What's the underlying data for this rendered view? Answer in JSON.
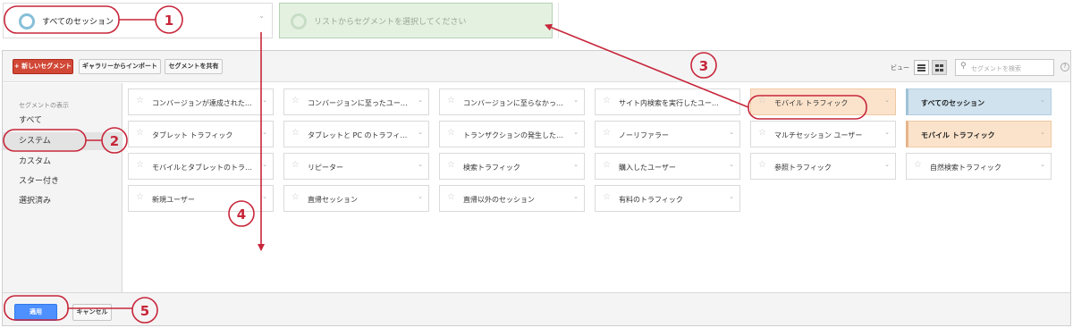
{
  "segment_bar": {
    "slot1_label": "すべてのセッション",
    "slot2_label": "リストからセグメントを選択してください"
  },
  "toolbar": {
    "new_segment": "+ 新しいセグメント",
    "import_gallery": "ギャラリーからインポート",
    "share_segments": "セグメントを共有",
    "view_label": "ビュー",
    "search_placeholder": "セグメントを検索",
    "help": "?"
  },
  "sidebar": {
    "heading": "セグメントの表示",
    "items": [
      {
        "label": "すべて"
      },
      {
        "label": "システム"
      },
      {
        "label": "カスタム"
      },
      {
        "label": "スター付き"
      },
      {
        "label": "選択済み"
      }
    ]
  },
  "segments": [
    {
      "label": "コンバージョンが達成されたセ..."
    },
    {
      "label": "コンバージョンに至ったユーザー"
    },
    {
      "label": "コンバージョンに至らなかった..."
    },
    {
      "label": "サイト内検索を実行したユーザー"
    },
    {
      "label": "モバイル トラフィック"
    },
    {
      "label": "すべてのセッション"
    },
    {
      "label": "タブレット トラフィック"
    },
    {
      "label": "タブレットと PC のトラフィック"
    },
    {
      "label": "トランザクションの発生したセッ..."
    },
    {
      "label": "ノーリファラー"
    },
    {
      "label": "マルチセッション ユーザー"
    },
    {
      "label": "モバイル トラフィック"
    },
    {
      "label": "モバイルとタブレットのトラフィック"
    },
    {
      "label": "リピーター"
    },
    {
      "label": "検索トラフィック"
    },
    {
      "label": "購入したユーザー"
    },
    {
      "label": "参照トラフィック"
    },
    {
      "label": "自然検索トラフィック"
    },
    {
      "label": "新規ユーザー"
    },
    {
      "label": "直帰セッション"
    },
    {
      "label": "直帰以外のセッション"
    },
    {
      "label": "有料のトラフィック"
    }
  ],
  "footer": {
    "apply": "適用",
    "cancel": "キャンセル"
  },
  "annotations": [
    "1",
    "2",
    "3",
    "4",
    "5"
  ],
  "colors": {
    "annotation": "#c7263a",
    "apply_button": "#4d90fe",
    "new_segment_button": "#d14836",
    "selected_segment": "#fbe3cb",
    "active_segment": "#cfe2ee",
    "segment_slot_empty": "#e4f1e1"
  }
}
